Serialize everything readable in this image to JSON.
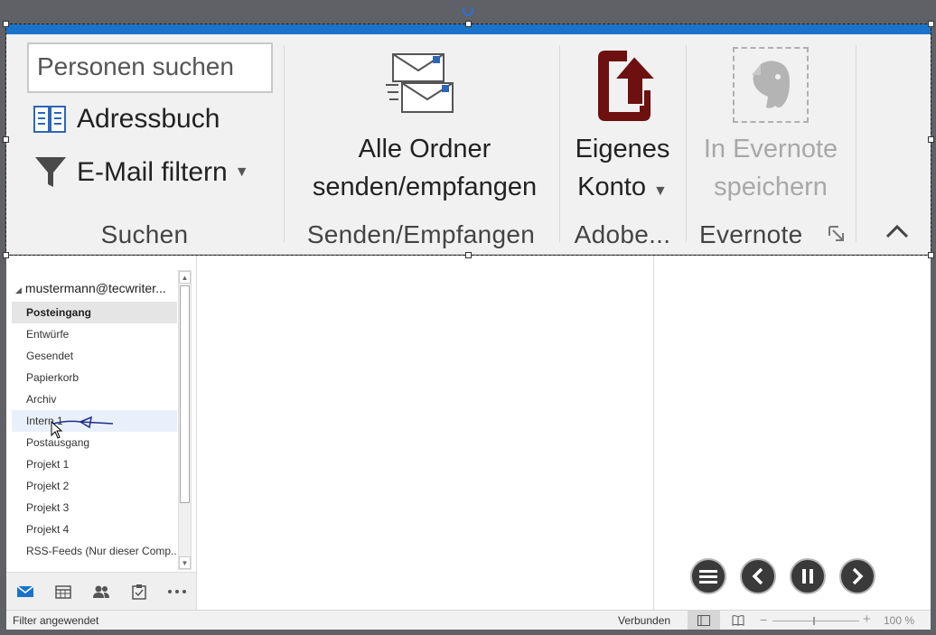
{
  "ribbon": {
    "groups": {
      "suchen": {
        "label": "Suchen",
        "search_placeholder": "Personen suchen",
        "addressbook_label": "Adressbuch",
        "filter_label": "E-Mail filtern"
      },
      "senden": {
        "label": "Senden/Empfangen",
        "button_line1": "Alle Ordner",
        "button_line2": "senden/empfangen"
      },
      "adobe": {
        "label": "Adobe...",
        "button_line1": "Eigenes",
        "button_line2": "Konto"
      },
      "evernote": {
        "label": "Evernote",
        "button_line1": "In Evernote",
        "button_line2": "speichern"
      }
    },
    "colors": {
      "accent": "#1a73c8",
      "adobe_red": "#6e0f10"
    }
  },
  "folders": {
    "account": "mustermann@tecwriter...",
    "items": [
      {
        "label": "Posteingang"
      },
      {
        "label": "Entwürfe"
      },
      {
        "label": "Gesendet"
      },
      {
        "label": "Papierkorb"
      },
      {
        "label": "Archiv"
      },
      {
        "label": "Intern 1"
      },
      {
        "label": "Postausgang"
      },
      {
        "label": "Projekt 1"
      },
      {
        "label": "Projekt 2"
      },
      {
        "label": "Projekt 3"
      },
      {
        "label": "Projekt 4"
      },
      {
        "label": "RSS-Feeds (Nur dieser Comp..."
      }
    ]
  },
  "nav": {
    "items": [
      "mail-icon",
      "calendar-icon",
      "people-icon",
      "tasks-icon",
      "more-icon"
    ]
  },
  "player": {
    "buttons": [
      "menu-icon",
      "previous-icon",
      "pause-icon",
      "next-icon"
    ]
  },
  "statusbar": {
    "left": "Filter angewendet",
    "connection": "Verbunden",
    "zoom": "100 %"
  }
}
